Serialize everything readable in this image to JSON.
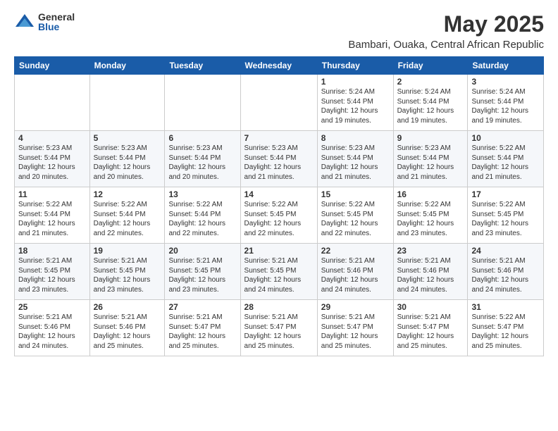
{
  "logo": {
    "general": "General",
    "blue": "Blue"
  },
  "title": "May 2025",
  "location": "Bambari, Ouaka, Central African Republic",
  "days_of_week": [
    "Sunday",
    "Monday",
    "Tuesday",
    "Wednesday",
    "Thursday",
    "Friday",
    "Saturday"
  ],
  "weeks": [
    [
      {
        "day": "",
        "info": ""
      },
      {
        "day": "",
        "info": ""
      },
      {
        "day": "",
        "info": ""
      },
      {
        "day": "",
        "info": ""
      },
      {
        "day": "1",
        "info": "Sunrise: 5:24 AM\nSunset: 5:44 PM\nDaylight: 12 hours\nand 19 minutes."
      },
      {
        "day": "2",
        "info": "Sunrise: 5:24 AM\nSunset: 5:44 PM\nDaylight: 12 hours\nand 19 minutes."
      },
      {
        "day": "3",
        "info": "Sunrise: 5:24 AM\nSunset: 5:44 PM\nDaylight: 12 hours\nand 19 minutes."
      }
    ],
    [
      {
        "day": "4",
        "info": "Sunrise: 5:23 AM\nSunset: 5:44 PM\nDaylight: 12 hours\nand 20 minutes."
      },
      {
        "day": "5",
        "info": "Sunrise: 5:23 AM\nSunset: 5:44 PM\nDaylight: 12 hours\nand 20 minutes."
      },
      {
        "day": "6",
        "info": "Sunrise: 5:23 AM\nSunset: 5:44 PM\nDaylight: 12 hours\nand 20 minutes."
      },
      {
        "day": "7",
        "info": "Sunrise: 5:23 AM\nSunset: 5:44 PM\nDaylight: 12 hours\nand 21 minutes."
      },
      {
        "day": "8",
        "info": "Sunrise: 5:23 AM\nSunset: 5:44 PM\nDaylight: 12 hours\nand 21 minutes."
      },
      {
        "day": "9",
        "info": "Sunrise: 5:23 AM\nSunset: 5:44 PM\nDaylight: 12 hours\nand 21 minutes."
      },
      {
        "day": "10",
        "info": "Sunrise: 5:22 AM\nSunset: 5:44 PM\nDaylight: 12 hours\nand 21 minutes."
      }
    ],
    [
      {
        "day": "11",
        "info": "Sunrise: 5:22 AM\nSunset: 5:44 PM\nDaylight: 12 hours\nand 21 minutes."
      },
      {
        "day": "12",
        "info": "Sunrise: 5:22 AM\nSunset: 5:44 PM\nDaylight: 12 hours\nand 22 minutes."
      },
      {
        "day": "13",
        "info": "Sunrise: 5:22 AM\nSunset: 5:44 PM\nDaylight: 12 hours\nand 22 minutes."
      },
      {
        "day": "14",
        "info": "Sunrise: 5:22 AM\nSunset: 5:45 PM\nDaylight: 12 hours\nand 22 minutes."
      },
      {
        "day": "15",
        "info": "Sunrise: 5:22 AM\nSunset: 5:45 PM\nDaylight: 12 hours\nand 22 minutes."
      },
      {
        "day": "16",
        "info": "Sunrise: 5:22 AM\nSunset: 5:45 PM\nDaylight: 12 hours\nand 23 minutes."
      },
      {
        "day": "17",
        "info": "Sunrise: 5:22 AM\nSunset: 5:45 PM\nDaylight: 12 hours\nand 23 minutes."
      }
    ],
    [
      {
        "day": "18",
        "info": "Sunrise: 5:21 AM\nSunset: 5:45 PM\nDaylight: 12 hours\nand 23 minutes."
      },
      {
        "day": "19",
        "info": "Sunrise: 5:21 AM\nSunset: 5:45 PM\nDaylight: 12 hours\nand 23 minutes."
      },
      {
        "day": "20",
        "info": "Sunrise: 5:21 AM\nSunset: 5:45 PM\nDaylight: 12 hours\nand 23 minutes."
      },
      {
        "day": "21",
        "info": "Sunrise: 5:21 AM\nSunset: 5:45 PM\nDaylight: 12 hours\nand 24 minutes."
      },
      {
        "day": "22",
        "info": "Sunrise: 5:21 AM\nSunset: 5:46 PM\nDaylight: 12 hours\nand 24 minutes."
      },
      {
        "day": "23",
        "info": "Sunrise: 5:21 AM\nSunset: 5:46 PM\nDaylight: 12 hours\nand 24 minutes."
      },
      {
        "day": "24",
        "info": "Sunrise: 5:21 AM\nSunset: 5:46 PM\nDaylight: 12 hours\nand 24 minutes."
      }
    ],
    [
      {
        "day": "25",
        "info": "Sunrise: 5:21 AM\nSunset: 5:46 PM\nDaylight: 12 hours\nand 24 minutes."
      },
      {
        "day": "26",
        "info": "Sunrise: 5:21 AM\nSunset: 5:46 PM\nDaylight: 12 hours\nand 25 minutes."
      },
      {
        "day": "27",
        "info": "Sunrise: 5:21 AM\nSunset: 5:47 PM\nDaylight: 12 hours\nand 25 minutes."
      },
      {
        "day": "28",
        "info": "Sunrise: 5:21 AM\nSunset: 5:47 PM\nDaylight: 12 hours\nand 25 minutes."
      },
      {
        "day": "29",
        "info": "Sunrise: 5:21 AM\nSunset: 5:47 PM\nDaylight: 12 hours\nand 25 minutes."
      },
      {
        "day": "30",
        "info": "Sunrise: 5:21 AM\nSunset: 5:47 PM\nDaylight: 12 hours\nand 25 minutes."
      },
      {
        "day": "31",
        "info": "Sunrise: 5:22 AM\nSunset: 5:47 PM\nDaylight: 12 hours\nand 25 minutes."
      }
    ]
  ]
}
